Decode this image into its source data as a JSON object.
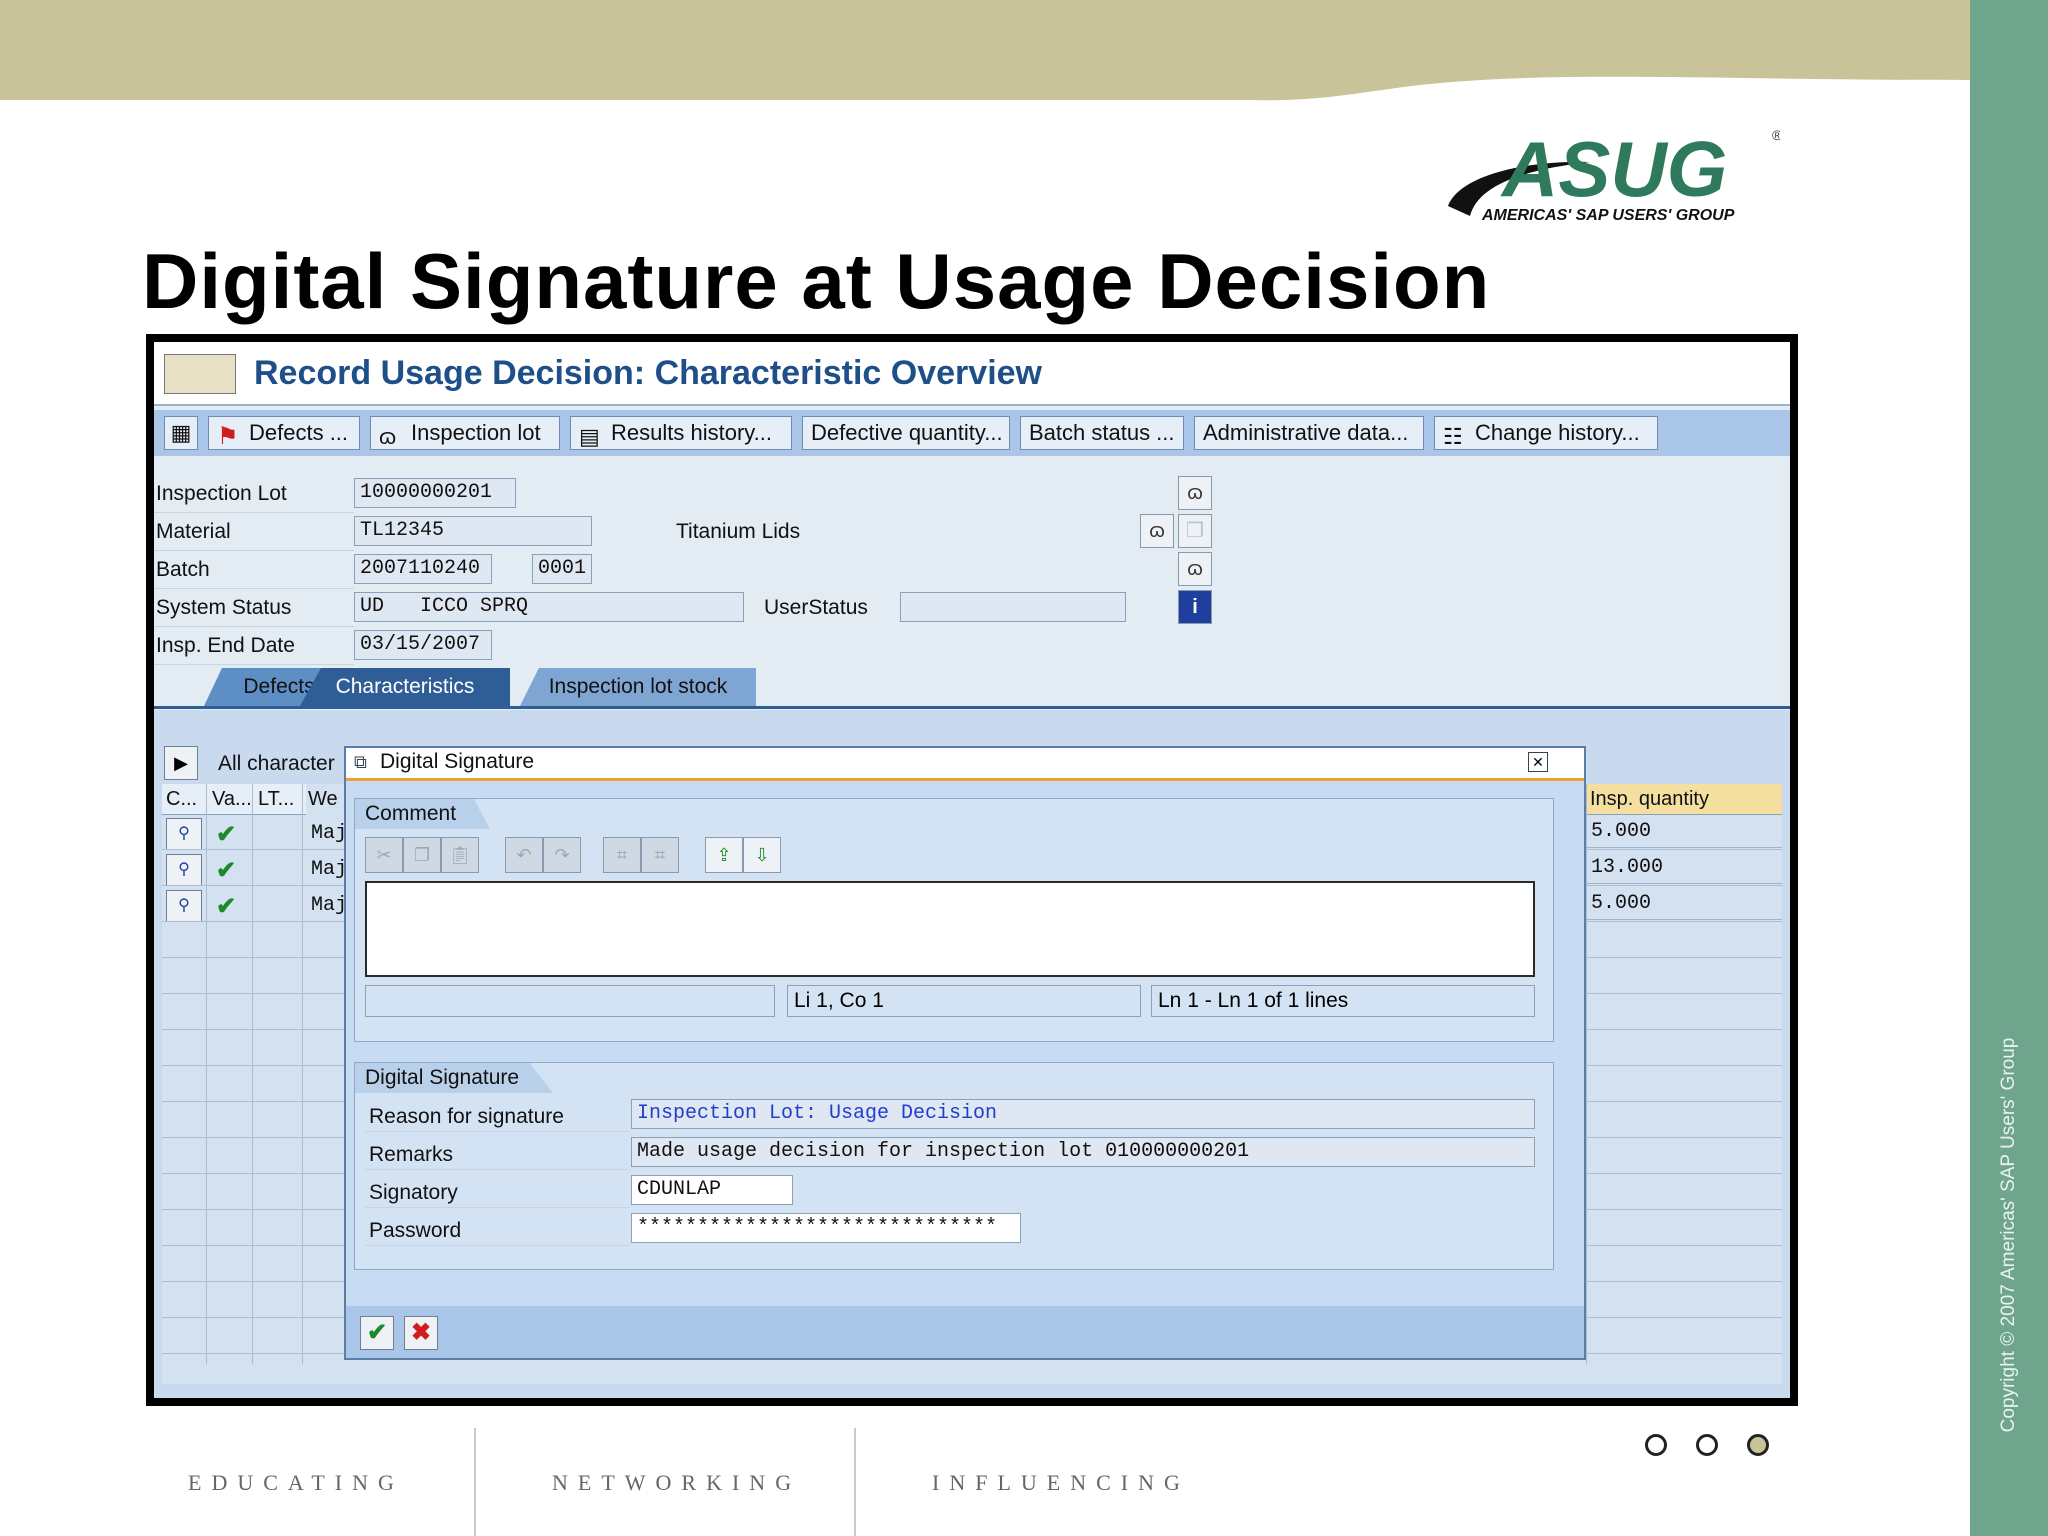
{
  "slide": {
    "title": "Digital Signature at Usage Decision",
    "logo_text": "ASUG",
    "logo_subtext": "AMERICAS' SAP USERS' GROUP",
    "copyright": "Copyright © 2007 Americas' SAP Users' Group",
    "footer": [
      "EDUCATING",
      "NETWORKING",
      "INFLUENCING"
    ],
    "colors": {
      "top_band": "#c9c39a",
      "right_band": "#6ea58c",
      "logo": "#2f7a5c"
    }
  },
  "sap": {
    "screen_title": "Record Usage Decision: Characteristic Overview",
    "toolbar": {
      "defects": "Defects ...",
      "inspection_lot": "Inspection lot",
      "results_history": "Results history...",
      "defective_quantity": "Defective quantity...",
      "batch_status": "Batch status ...",
      "administrative_data": "Administrative data...",
      "change_history": "Change history..."
    },
    "header": {
      "inspection_lot_label": "Inspection Lot",
      "inspection_lot_value": "10000000201",
      "material_label": "Material",
      "material_value": "TL12345",
      "material_desc": "Titanium Lids",
      "batch_label": "Batch",
      "batch_value": "2007110240",
      "batch_sub": "0001",
      "system_status_label": "System Status",
      "system_status_value": "UD   ICCO SPRQ",
      "user_status_label": "UserStatus",
      "user_status_value": "",
      "insp_end_date_label": "Insp. End Date",
      "insp_end_date_value": "03/15/2007"
    },
    "tabs": [
      "Defects",
      "Characteristics",
      "Inspection lot stock"
    ],
    "grid": {
      "all_characteristics": "All character",
      "columns": [
        "C...",
        "Va...",
        "LT...",
        "We"
      ],
      "right_column": "Insp. quantity",
      "rows": [
        {
          "we": "Maj",
          "qty": "5.000"
        },
        {
          "we": "Maj",
          "qty": "13.000"
        },
        {
          "we": "Maj",
          "qty": "5.000"
        }
      ]
    }
  },
  "dialog": {
    "title": "Digital Signature",
    "comment_group": "Comment",
    "comment_text": "",
    "status_position": "Li 1, Co 1",
    "status_lines": "Ln 1 - Ln 1 of 1 lines",
    "signature_group": "Digital Signature",
    "fields": {
      "reason_label": "Reason for signature",
      "reason_value": "Inspection Lot: Usage Decision",
      "remarks_label": "Remarks",
      "remarks_value": "Made usage decision for inspection lot 010000000201",
      "signatory_label": "Signatory",
      "signatory_value": "CDUNLAP",
      "password_label": "Password",
      "password_value": "******************************"
    }
  }
}
